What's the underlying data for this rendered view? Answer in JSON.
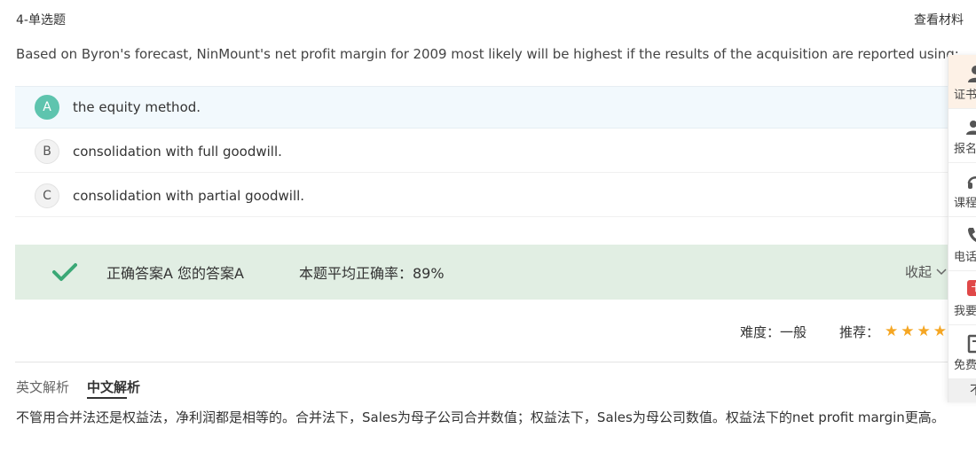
{
  "header": {
    "question_type": "4-单选题",
    "view_material": "查看材料"
  },
  "question": {
    "text": "Based on Byron's forecast, NinMount's net profit margin for 2009 most likely will be highest if the results of the acquisition are reported using:",
    "options": [
      {
        "letter": "A",
        "text": "the equity method.",
        "selected": true
      },
      {
        "letter": "B",
        "text": "consolidation with full goodwill.",
        "selected": false
      },
      {
        "letter": "C",
        "text": "consolidation with partial goodwill.",
        "selected": false
      }
    ]
  },
  "answer": {
    "correct_text": "正确答案A 您的答案A",
    "average_text": "本题平均正确率：89%",
    "collapse_label": "收起",
    "average_rate_percent": 89
  },
  "meta": {
    "difficulty": "难度：一般",
    "recommend_label": "推荐：",
    "recommend_stars": 4
  },
  "analysis": {
    "tab_en": "英文解析",
    "tab_zh": "中文解析",
    "text": "不管用合并法还是权益法，净利润都是相等的。合并法下，Sales为母子公司合并数值；权益法下，Sales为母公司数值。权益法下的net profit margin更高。"
  },
  "side_panel": {
    "items": [
      {
        "label": "证书",
        "icon": "person-icon"
      },
      {
        "label": "报名",
        "icon": "people-icon"
      },
      {
        "label": "课程",
        "icon": "headset-icon"
      },
      {
        "label": "电话",
        "icon": "phone-icon"
      },
      {
        "label": "我要",
        "icon": "badge-icon",
        "badge_text": "卡"
      },
      {
        "label": "免费",
        "icon": "book-icon"
      }
    ],
    "bottom_label": "不"
  },
  "colors": {
    "accent_green": "#5ec4ae",
    "answer_bar_bg": "#e1eee3",
    "check_green": "#3aa876",
    "star": "#f5a623",
    "selected_option_bg": "#f2f9fd"
  }
}
